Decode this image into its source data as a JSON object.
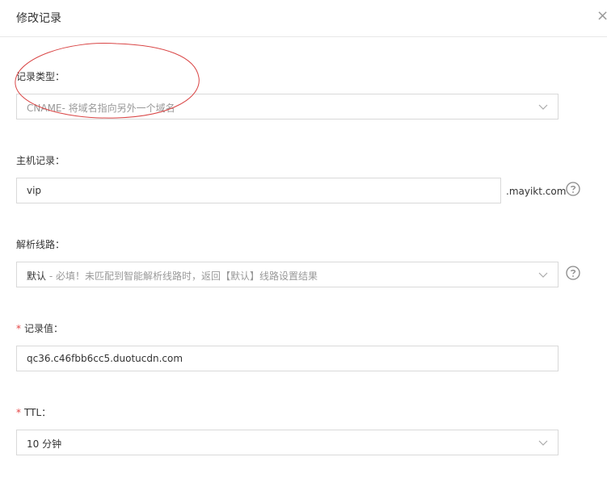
{
  "dialog": {
    "title": "修改记录",
    "close_label": "×"
  },
  "fields": {
    "record_type": {
      "label": "记录类型：",
      "value": "CNAME",
      "value_hint": "- 将域名指向另外一个域名"
    },
    "host_record": {
      "label": "主机记录：",
      "value": "vip",
      "suffix": ".mayikt.com"
    },
    "line": {
      "label": "解析线路：",
      "value": "默认",
      "value_hint": " - 必填！未匹配到智能解析线路时，返回【默认】线路设置结果"
    },
    "record_value": {
      "required_mark": "*",
      "label": "记录值：",
      "value": "qc36.c46fbb6cc5.duotucdn.com"
    },
    "ttl": {
      "required_mark": "*",
      "label": "TTL：",
      "value": "10 分钟"
    }
  },
  "icons": [
    "close-icon",
    "chevron-down-icon",
    "help-circle-icon"
  ],
  "colors": {
    "required": "#e54545",
    "annotation": "#d94545",
    "border": "#d9d9d9"
  }
}
